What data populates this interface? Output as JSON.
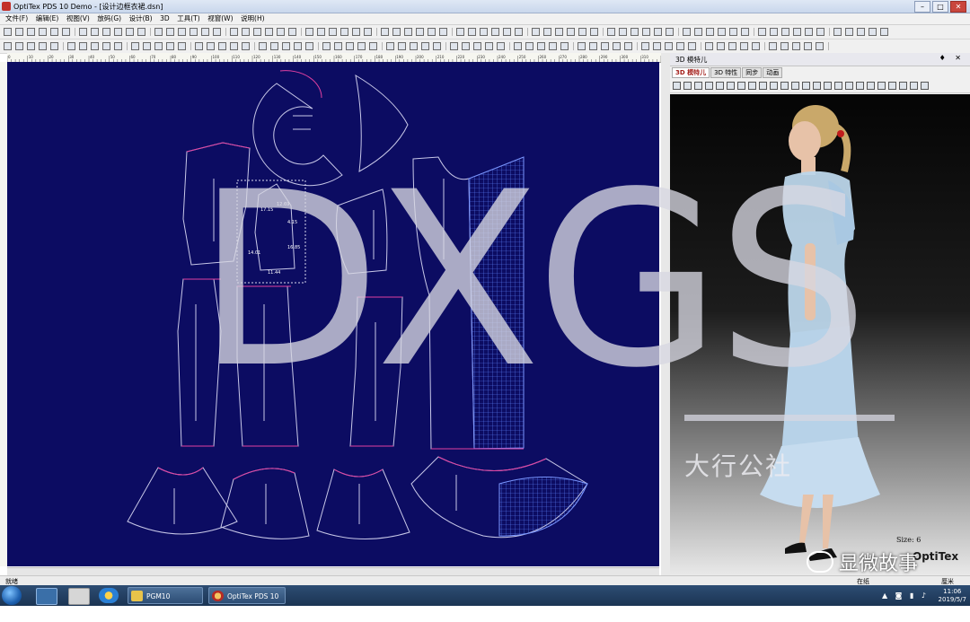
{
  "window": {
    "title": "OptiTex PDS 10 Demo - [设计边框衣裙.dsn]",
    "buttons": {
      "minimize": "–",
      "maximize": "□",
      "close": "✕"
    }
  },
  "menu": [
    "文件(F)",
    "编辑(E)",
    "视图(V)",
    "放码(G)",
    "设计(B)",
    "3D",
    "工具(T)",
    "视窗(W)",
    "说明(H)"
  ],
  "ruler": {
    "top": [
      "0",
      "10",
      "20",
      "30",
      "40",
      "50",
      "60",
      "70",
      "80",
      "90",
      "100",
      "110",
      "120",
      "130",
      "140",
      "150",
      "160",
      "170",
      "180",
      "190",
      "200",
      "210",
      "220",
      "230",
      "240",
      "250",
      "260",
      "270",
      "280",
      "290",
      "300",
      "310",
      "320"
    ]
  },
  "pattern_labels": {
    "l1": "12.69",
    "l2": "17.15",
    "l3": "4.15",
    "l4": "16.85",
    "l5": "14.01",
    "l6": "11.44"
  },
  "panel": {
    "title": "3D 模特儿",
    "pin": "♦ ✕",
    "tabs": [
      "3D 模特儿",
      "3D 特性",
      "同步",
      "动画"
    ],
    "size_label": "Size: 6",
    "brand": "OptiTex"
  },
  "statusbar": {
    "left": "就绪",
    "mid": "在纸",
    "right": "厘米"
  },
  "taskbar": {
    "buttons": [
      {
        "label": "PGM10"
      },
      {
        "label": "OptiTex PDS 10 ..."
      }
    ],
    "time": "11:06",
    "date": "2019/5/7"
  },
  "watermark": {
    "main": "DXGS",
    "sub": "大行公社",
    "wechat": "显微故事"
  },
  "colors": {
    "canvas": "#0c0c62",
    "pattern_line": "#c8c8e8",
    "seam": "#e040a0",
    "grid_fill": "#2b55e0"
  }
}
